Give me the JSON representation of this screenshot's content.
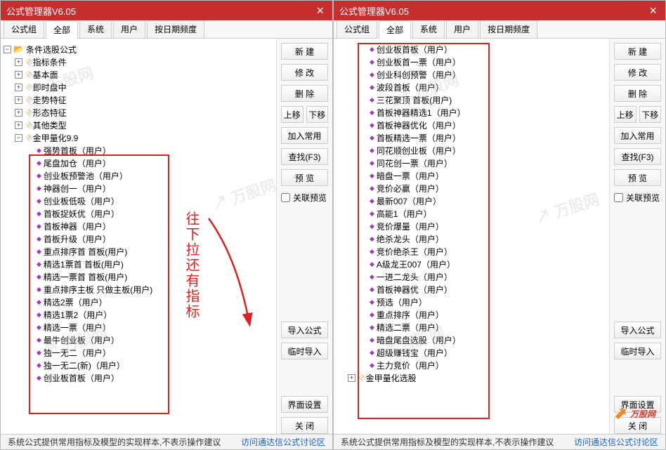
{
  "title": "公式管理器V6.05",
  "tabs": [
    "公式组",
    "全部",
    "系统",
    "用户",
    "按日期频度"
  ],
  "activeTab": "全部",
  "buttons": {
    "new": "新 建",
    "edit": "修 改",
    "delete": "删 除",
    "up": "上移",
    "down": "下移",
    "addFav": "加入常用",
    "find": "查找(F3)",
    "preview": "预 览",
    "linkPreview": "关联预览",
    "import": "导入公式",
    "tempImport": "临时导入",
    "uiSettings": "界面设置",
    "close": "关 闭"
  },
  "status_left": "系统公式提供常用指标及模型的实现样本,不表示操作建议",
  "status_right": "访问通达信公式讨论区",
  "left_tree": {
    "root": "条件选股公式",
    "cats": [
      "指标条件",
      "基本面",
      "即时盘中",
      "走势特征",
      "形态特征",
      "其他类型"
    ],
    "open_cat": "金甲量化9.9",
    "items": [
      "强势首板（用户）",
      "尾盘加仓（用户）",
      "创业板预警池（用户）",
      "神器创一（用户）",
      "创业板低吸（用户）",
      "首板捉妖优（用户）",
      "首板神器（用户）",
      "首板升级（用户）",
      "重点排序首 首板(用户)",
      "精选1票首 首板(用户)",
      "精选一票首 首板(用户)",
      "重点排序主板 只做主板(用户)",
      "精选2票（用户）",
      "精选1票2（用户）",
      "精选一票（用户）",
      "最牛创业板（用户）",
      "独一无二（用户）",
      "独一无二(新)（用户）",
      "创业板首板（用户）"
    ]
  },
  "right_tree": {
    "items": [
      "创业板首板（用户）",
      "创业板首一票（用户）",
      "创业科创预警（用户）",
      "波段首板（用户）",
      "三花聚顶 首板(用户)",
      "首板神器精选1（用户）",
      "首板神器优化（用户）",
      "首板精选一票（用户）",
      "同花顺创业板（用户）",
      "同花创一票（用户）",
      "暗盘一票（用户）",
      "竞价必赢（用户）",
      "最新007（用户）",
      "高能1（用户）",
      "竞价爆量（用户）",
      "绝杀龙头（用户）",
      "竞价绝杀王（用户）",
      "A级龙王007（用户）",
      "一进二龙头（用户）",
      "首板神器优（用户）",
      "预选（用户）",
      "重点排序（用户）",
      "精选二票（用户）",
      "暗盘尾盘选股（用户）",
      "超级赚钱宝（用户）",
      "主力竞价（用户）"
    ],
    "bottom": "金甲量化选股"
  },
  "annotation": "往下拉还有指标"
}
